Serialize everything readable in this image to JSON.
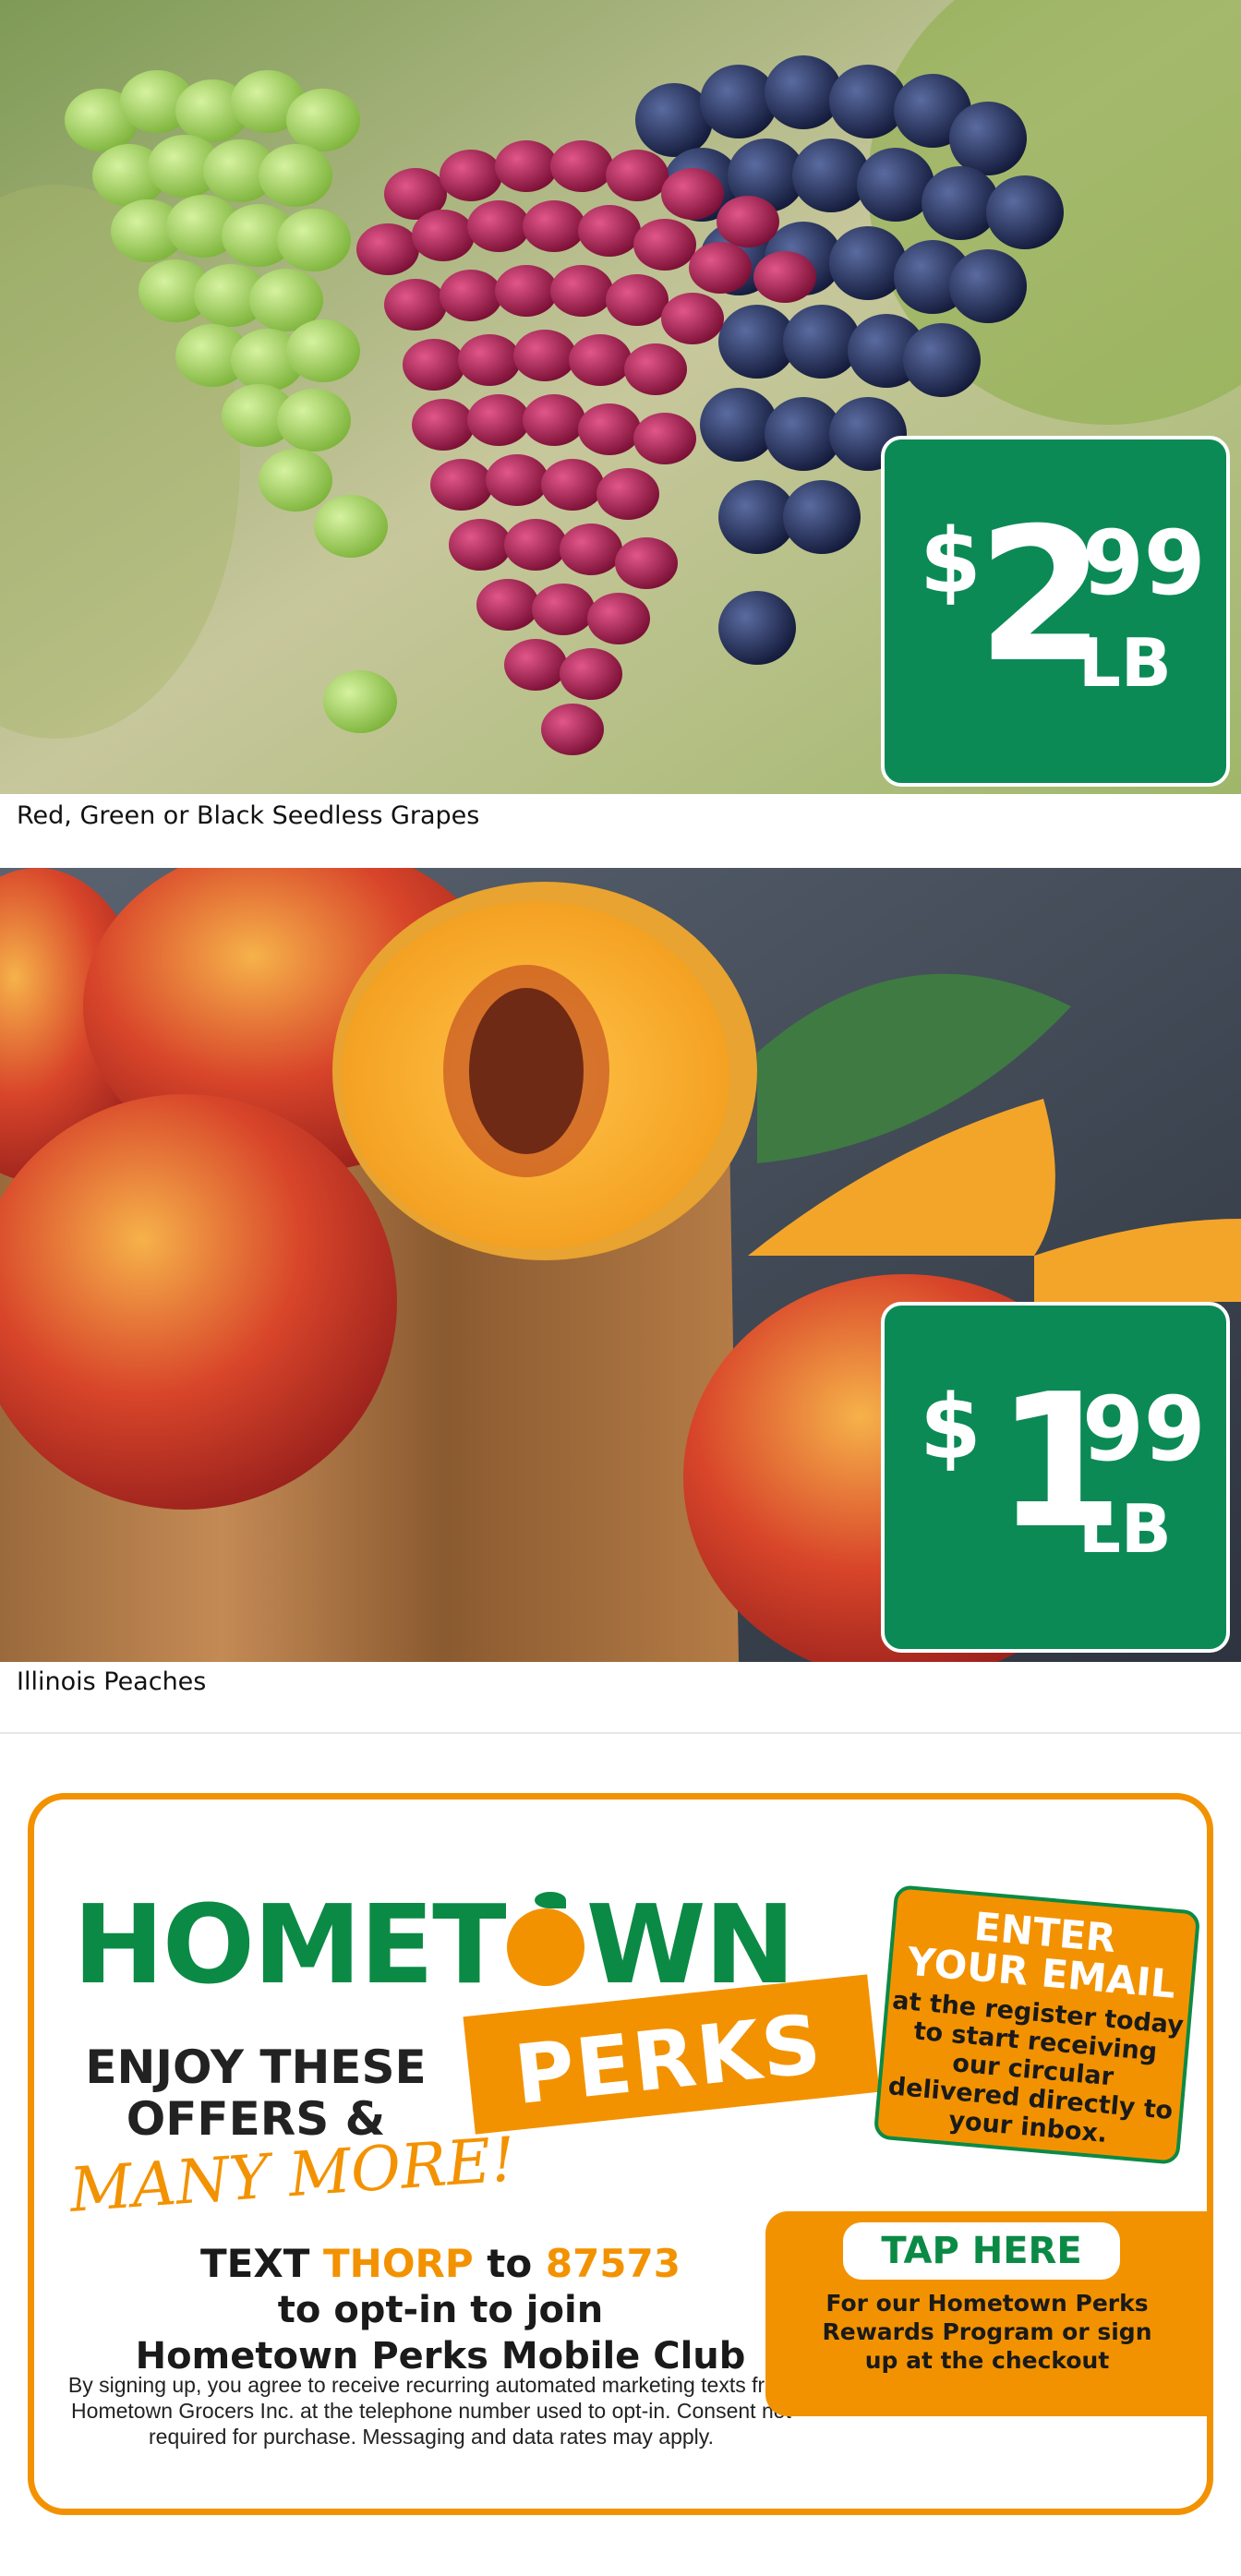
{
  "products": [
    {
      "name": "Red, Green or Black Seedless Grapes",
      "price": {
        "dollar_sign": "$",
        "whole": "2",
        "cents": "99",
        "unit": "LB"
      },
      "image": "grapes-photo"
    },
    {
      "name": "Illinois Peaches",
      "price": {
        "dollar_sign": "$",
        "whole": "1",
        "cents": "99",
        "unit": "LB"
      },
      "image": "peaches-photo"
    }
  ],
  "promo": {
    "brand_left": "HOMET",
    "brand_right": "WN",
    "perks": "PERKS",
    "enjoy_line1": "ENJOY THESE",
    "enjoy_line2": "OFFERS &",
    "many_more": "MANY MORE!",
    "enter_big1": "ENTER",
    "enter_big2": "YOUR EMAIL",
    "enter_small": "at the register today to start receiving our circular delivered directly to your inbox.",
    "text_word": "TEXT",
    "keyword": "THORP",
    "to_word": "to",
    "shortcode": "87573",
    "optin_line": "to opt-in to join",
    "club_line": "Hometown Perks Mobile Club",
    "disclaimer": "By signing up, you agree to receive recurring automated marketing texts from Hometown Grocers Inc. at the telephone number used to opt-in. Consent not required for purchase. Messaging and data rates may apply.",
    "tap_here": "TAP HERE",
    "tap_sub": "For our Hometown Perks Rewards Program or sign up at the checkout"
  },
  "colors": {
    "brand_green": "#0b8a45",
    "price_green": "#0b8a55",
    "brand_orange": "#f39200"
  }
}
